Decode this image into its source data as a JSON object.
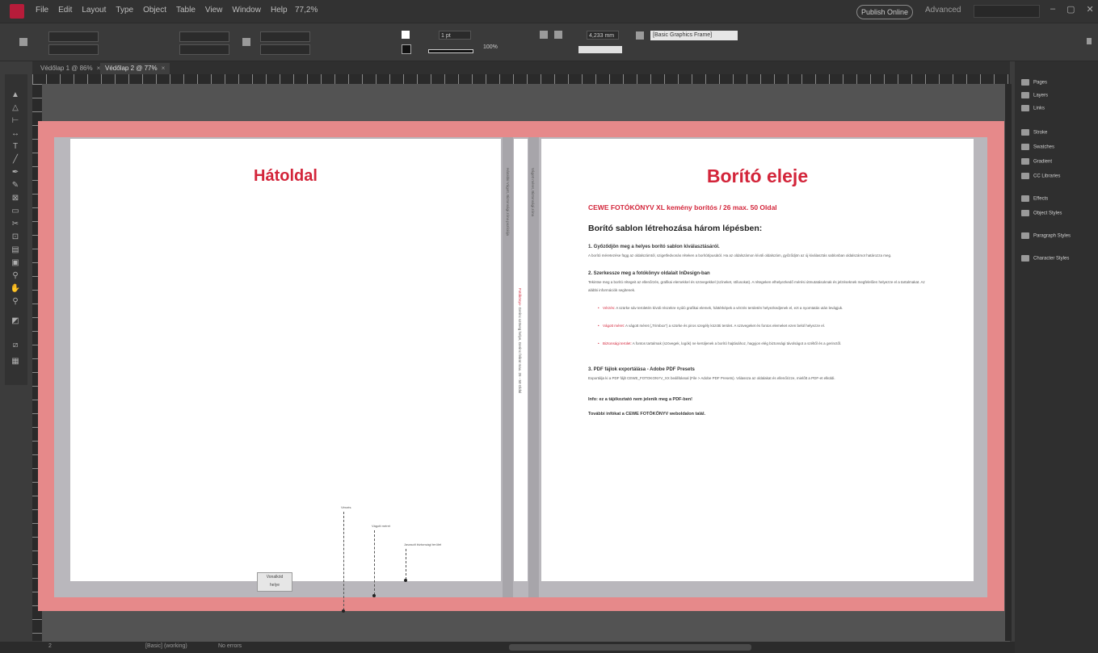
{
  "app": {
    "menus": [
      "File",
      "Edit",
      "Layout",
      "Type",
      "Object",
      "Table",
      "View",
      "Window",
      "Help"
    ],
    "zoom": "77,2%",
    "publish_online": "Publish Online",
    "workspace": "Advanced",
    "window_controls": [
      "–",
      "▢",
      "✕"
    ]
  },
  "control_bar": {
    "stroke_weight": "1 pt",
    "opacity": "100%",
    "measure": "4,233 mm",
    "frame_type": "[Basic Graphics Frame]"
  },
  "tabs": [
    {
      "label": "Védőlap 1 @ 86%",
      "close": "×"
    },
    {
      "label": "Védőlap 2 @ 77%",
      "close": "×"
    }
  ],
  "document": {
    "back_title": "Hátoldal",
    "front_title": "Borító eleje",
    "front_subtitle": "CEWE FOTÓKÖNYV XL kemény borítós  / 26 max. 50 Oldal",
    "front_heading": "Borító sablon létrehozása három lépésben:",
    "step1_title": "1.   Győződjön meg a helyes borító sablon kiválasztásáról.",
    "step1_body": "A borító méretezése függ az oldalszámtól, szigetfedvonás réteken a borítótípusától. Ha az oldalszámon kívüli oldalszám, győződjön az új kiválasztás sablonban oldalszámot határozza meg.",
    "step2_title": "2.   Szerkessze meg a fotókönyv oldalait InDesign-ban",
    "step2_body": "Tekintse meg a borító rétegeit az ellenőrzés, grafikai elemekkel és szövegekkel (színeket, stílusokat). A rétegeken elhelyezkedő mérési útmutatásoknak és jelzéseknek megfelelően helyezze el a tartalmakat. Az alábbi információk segítenek.",
    "bullets": [
      {
        "key": "Vérzés:",
        "text": "A szürke sáv területén kívüli részekre nyúló grafikai elemek, háttérképek a vérzés területén helyezkedjenek el, ezt a nyomtatás után levágjuk."
      },
      {
        "key": "Vágott méret:",
        "text": "A vágott méret („Trimbox”) a szürke és piros szegély közötti terület. A szövegeket és fontos elemeket ezen belül helyezze el."
      },
      {
        "key": "Biztonsági terület:",
        "text": "A fontos tartalmak (szövegek, logók) ne kerüljenek a borító hajtásához, hagyjon elég biztonsági távolságot a széltől és a gerinctől."
      }
    ],
    "step3_title": "3.   PDF fájlok exportálása - Adobe PDF Presets",
    "step3_body": "Exportálja ki a PDF fájlt CEWE_FOTOKONYV_XX beállítással (File > Adobe PDF Presets). Válassza az oldalakat és ellenőrizze, mielőtt a PDF-et elküldi.",
    "note1": "Info: ez a tájékoztató nem jelenik meg a PDF-ben!",
    "note2": "További infókat a CEWE FOTÓKÖNYV weboldalon talál.",
    "spine_left_text": "Hátoldal Vágott, Biztonsági zóna pozíciója",
    "spine_right_text": "Vágott méret, Biztonsági zóna",
    "spine_middle_red": "Fotókönyv",
    "spine_middle_text": "- Gerinc szöveg helye, Gerinc felirat max. 26 - 50 Oldal",
    "ann_bleed": "Vérzés",
    "ann_trim": "Vágott méret",
    "ann_safe": "Javasolt biztonsági terület",
    "barcode_line1": "Vonalkód",
    "barcode_line2": "helye"
  },
  "panels": [
    {
      "label": "Pages"
    },
    {
      "label": "Layers"
    },
    {
      "label": "Links"
    },
    {
      "label": "Stroke"
    },
    {
      "label": "Swatches"
    },
    {
      "label": "Gradient"
    },
    {
      "label": "CC Libraries"
    },
    {
      "label": "Effects"
    },
    {
      "label": "Object Styles"
    },
    {
      "label": "Paragraph Styles"
    },
    {
      "label": "Character Styles"
    }
  ],
  "status": {
    "page": "2",
    "preflight": "[Basic] (working)",
    "errors": "No errors"
  },
  "colors": {
    "accent_red": "#d3253a",
    "bleed_pink": "#e6898a",
    "slug_gray": "#b9b7bc"
  }
}
